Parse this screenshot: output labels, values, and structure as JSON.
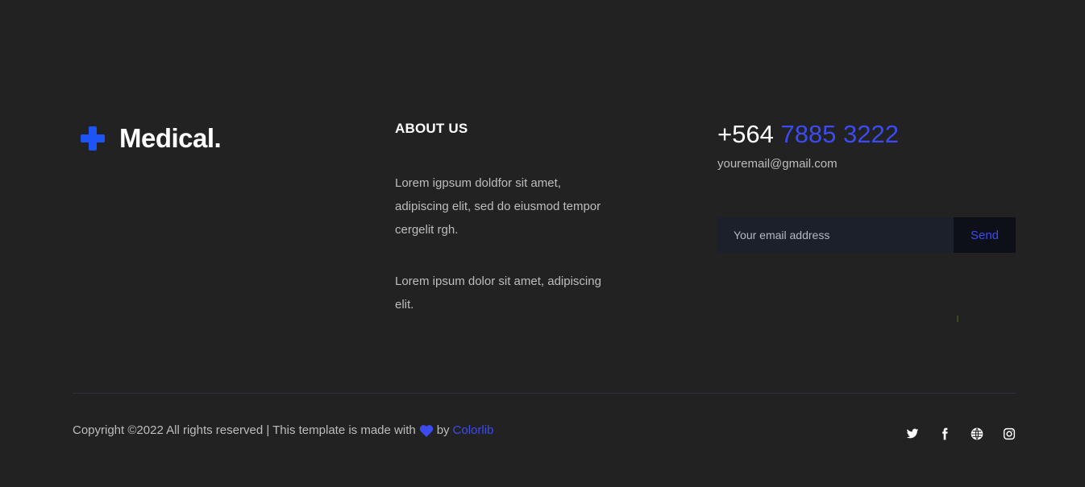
{
  "brand": {
    "name": "Medical.",
    "icon": "crescent-cross-logo",
    "accent_color": "#1e54f5"
  },
  "about": {
    "title": "ABOUT US",
    "paragraph1": "Lorem igpsum doldfor sit amet, adipiscing elit, sed do eiusmod tempor cergelit rgh.",
    "paragraph2": "Lorem ipsum dolor sit amet, adipiscing elit."
  },
  "contact": {
    "phone_prefix": "+564",
    "phone_number": "7885 3222",
    "email": "youremail@gmail.com"
  },
  "subscribe": {
    "placeholder": "Your email address",
    "button_label": "Send"
  },
  "footer": {
    "copyright_before": "Copyright ©2022 All rights reserved | This template is made with",
    "copyright_by": "by",
    "credit_link": "Colorlib",
    "heart_icon": "heart-icon",
    "link_color": "#3c4bf0"
  },
  "social": [
    {
      "name": "twitter-icon"
    },
    {
      "name": "facebook-icon"
    },
    {
      "name": "globe-icon"
    },
    {
      "name": "instagram-icon"
    }
  ]
}
